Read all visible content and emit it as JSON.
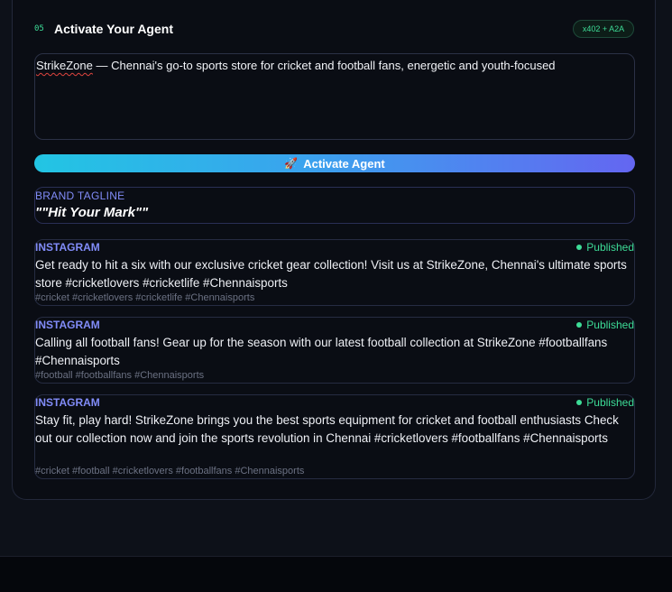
{
  "step": {
    "number": "05",
    "title": "Activate Your Agent",
    "badge": "x402 + A2A"
  },
  "prompt": {
    "brand_name": "StrikeZone",
    "description": " — Chennai's go-to sports store for cricket and football fans, energetic and youth-focused"
  },
  "activate_button": {
    "icon": "rocket-icon",
    "label": "Activate Agent"
  },
  "tagline": {
    "label": "BRAND TAGLINE",
    "text": "\"\"Hit Your Mark\"\""
  },
  "posts": [
    {
      "platform": "INSTAGRAM",
      "status": "Published",
      "body": "Get ready to hit a six with our exclusive cricket gear collection! Visit us at StrikeZone, Chennai's ultimate sports store #cricketlovers #cricketlife #Chennaisports",
      "hashtags": "#cricket #cricketlovers #cricketlife #Chennaisports"
    },
    {
      "platform": "INSTAGRAM",
      "status": "Published",
      "body": "Calling all football fans! Gear up for the season with our latest football collection at StrikeZone #footballfans #Chennaisports",
      "hashtags": "#football #footballfans #Chennaisports"
    },
    {
      "platform": "INSTAGRAM",
      "status": "Published",
      "body": "Stay fit, play hard! StrikeZone brings you the best sports equipment for cricket and football enthusiasts Check out our collection now and join the sports revolution in Chennai #cricketlovers #footballfans #Chennaisports",
      "hashtags": "#cricket #football #cricketlovers #footballfans #Chennaisports"
    }
  ],
  "colors": {
    "accent_green": "#3ddc97",
    "accent_indigo": "#818cf8",
    "gradient_start": "#22c5e3",
    "gradient_end": "#6466f1"
  }
}
